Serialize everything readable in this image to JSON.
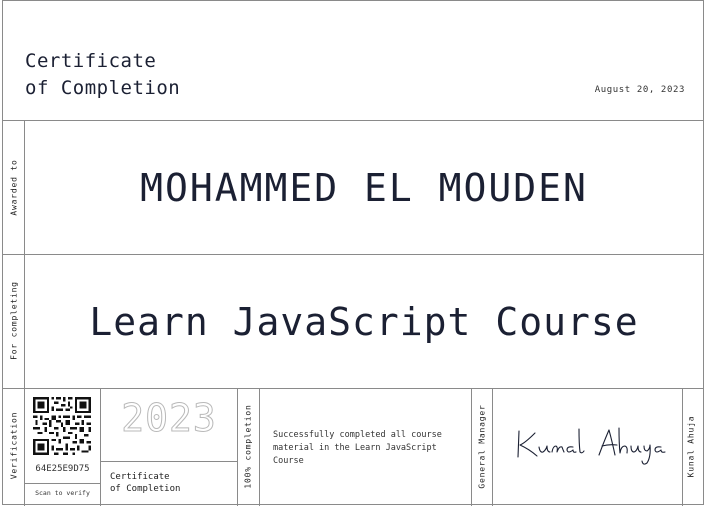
{
  "certificate": {
    "title_line1": "Certificate",
    "title_line2": "of Completion",
    "date": "August 20, 2023",
    "awarded_label": "Awarded to",
    "recipient": "MOHAMMED EL MOUDEN",
    "completing_label": "For completing",
    "course": "Learn JavaScript Course",
    "verification_label": "Verification",
    "verification_code": "64E25E9D75",
    "scan_text": "Scan to verify",
    "year": "2023",
    "mini_title_line1": "Certificate",
    "mini_title_line2": "of Completion",
    "completion_label": "100% completion",
    "description": "Successfully completed all course material in the Learn JavaScript Course",
    "signer_role": "General Manager",
    "signer_name": "Kunal Ahuja"
  },
  "colors": {
    "ink": "#1b2033",
    "rule": "#8a8a8a",
    "outline_text": "#b9b9b9"
  },
  "icons": {
    "qr": "qr-code-icon",
    "signature": "handwritten-signature"
  }
}
